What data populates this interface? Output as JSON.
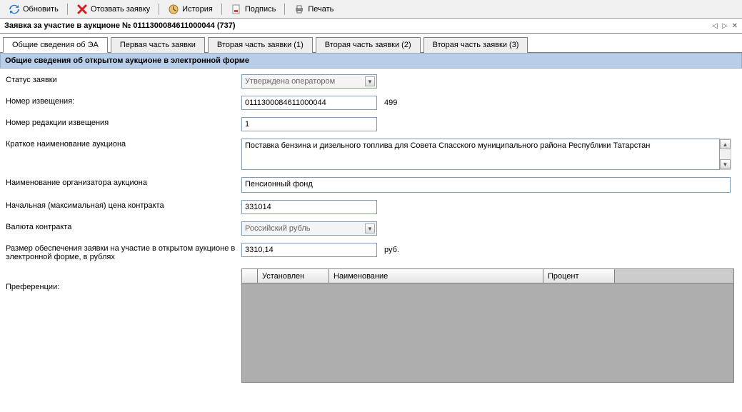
{
  "toolbar": {
    "refresh": "Обновить",
    "recall": "Отозвать заявку",
    "history": "История",
    "sign": "Подпись",
    "print": "Печать"
  },
  "window_title": "Заявка за участие в аукционе № 0111300084611000044 (737)",
  "tabs": [
    "Общие сведения об ЭА",
    "Первая часть заявки",
    "Вторая часть заявки (1)",
    "Вторая часть заявки (2)",
    "Вторая часть заявки (3)"
  ],
  "section_header": "Общие сведения об открытом аукционе в электронной форме",
  "labels": {
    "status": "Статус заявки",
    "notice_no": "Номер извещения:",
    "revision_no": "Номер редакции извещения",
    "short_name": "Краткое наименование аукциона",
    "organizer": "Наименование организатора аукциона",
    "start_price": "Начальная (максимальная) цена контракта",
    "currency": "Валюта контракта",
    "deposit": "Размер обеспечения заявки на участие в открытом аукционе в электронной форме, в рублях",
    "preferences": "Преференции:"
  },
  "values": {
    "status": "Утверждена оператором",
    "notice_no": "0111300084611000044",
    "notice_suffix": "499",
    "revision_no": "1",
    "short_name": "Поставка бензина и дизельного топлива для Совета Спасского муниципального района Республики Татарстан",
    "organizer": "Пенсионный фонд",
    "start_price": "331014",
    "currency": "Российский рубль",
    "deposit": "3310,14",
    "deposit_unit": "руб."
  },
  "grid": {
    "columns": [
      "Установлен",
      "Наименование",
      "Процент"
    ]
  }
}
